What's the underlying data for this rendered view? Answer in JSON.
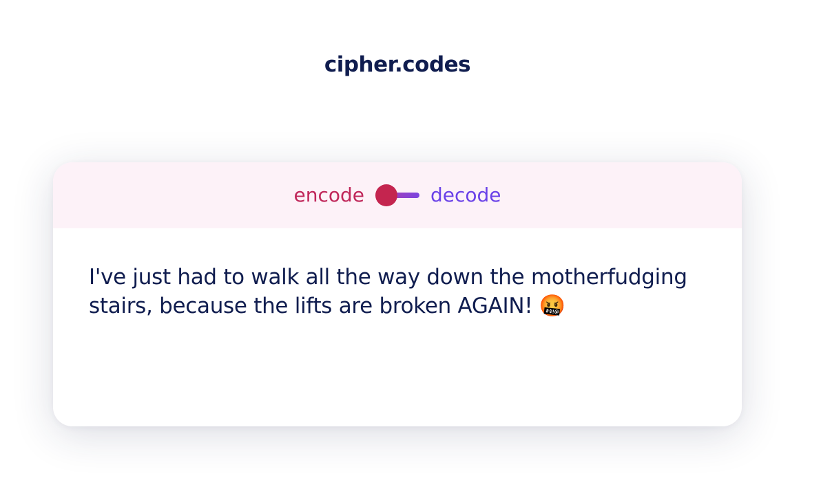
{
  "site": {
    "title": "cipher.codes"
  },
  "mode_toggle": {
    "encode_label": "encode",
    "decode_label": "decode",
    "selected": "encode"
  },
  "content": {
    "message": "I've just had to walk all the way down the motherfudging stairs, because the lifts are broken AGAIN! 🤬"
  },
  "colors": {
    "title": "#101d4f",
    "encode": "#c0275a",
    "decode": "#6a42e8",
    "header_bg": "#fdf2f8",
    "text": "#101d4f"
  }
}
